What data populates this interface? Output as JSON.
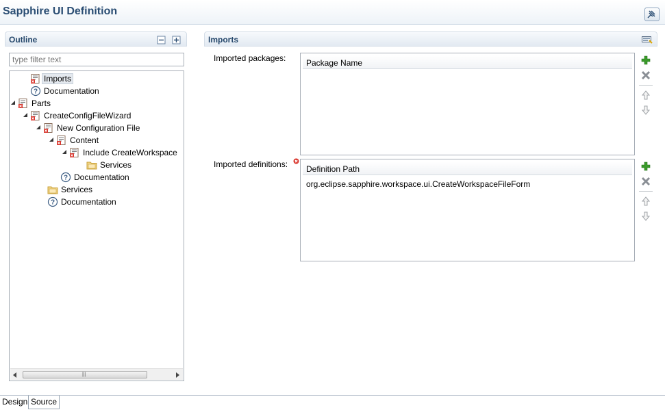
{
  "header": {
    "title": "Sapphire UI Definition"
  },
  "outline": {
    "title": "Outline",
    "filter_placeholder": "type filter text",
    "tree": [
      {
        "label": "Imports",
        "icon": "form-icon",
        "selected": true
      },
      {
        "label": "Documentation",
        "icon": "help-icon"
      },
      {
        "label": "Parts",
        "icon": "form-icon",
        "expanded": true
      },
      {
        "label": "CreateConfigFileWizard",
        "icon": "form-icon",
        "expanded": true
      },
      {
        "label": "New Configuration File",
        "icon": "form-icon",
        "expanded": true
      },
      {
        "label": "Content",
        "icon": "form-icon",
        "expanded": true
      },
      {
        "label": "Include CreateWorkspace",
        "icon": "form-icon",
        "expanded": true
      },
      {
        "label": "Services",
        "icon": "folder-icon"
      },
      {
        "label": "Documentation",
        "icon": "help-icon"
      },
      {
        "label": "Services",
        "icon": "folder-icon"
      },
      {
        "label": "Documentation",
        "icon": "help-icon"
      }
    ]
  },
  "imports": {
    "title": "Imports",
    "packages": {
      "label": "Imported packages:",
      "column": "Package Name",
      "rows": []
    },
    "definitions": {
      "label": "Imported definitions:",
      "column": "Definition Path",
      "rows": [
        "org.eclipse.sapphire.workspace.ui.CreateWorkspaceFileForm"
      ]
    }
  },
  "tabs": {
    "design": "Design",
    "source": "Source",
    "active": "Source"
  },
  "colors": {
    "title": "#2a4d73",
    "section_title": "#25476b",
    "add": "#3a9a2a",
    "error": "#d9342b"
  }
}
